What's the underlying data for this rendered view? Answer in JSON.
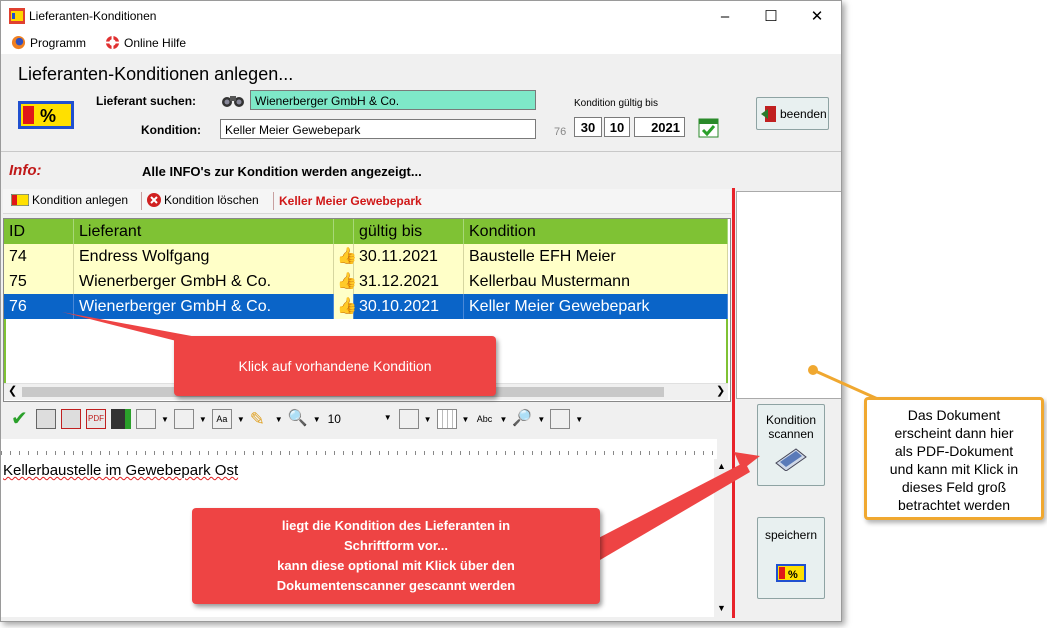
{
  "window": {
    "title": "Lieferanten-Konditionen"
  },
  "menu": {
    "items": [
      {
        "label": "Programm"
      },
      {
        "label": "Online Hilfe"
      }
    ]
  },
  "header": {
    "page_title": "Lieferanten-Konditionen anlegen...",
    "supplier_search_label": "Lieferant suchen:",
    "supplier_value": "Wienerberger GmbH & Co.",
    "condition_label": "Kondition:",
    "condition_value": "Keller Meier Gewebepark",
    "condition_id": "76",
    "valid_until_label": "Kondition gültig bis",
    "valid_day": "30",
    "valid_month": "10",
    "valid_year": "2021",
    "exit_label": "beenden",
    "logo_text": "%"
  },
  "info": {
    "label": "Info:",
    "text": "Alle INFO's zur Kondition werden angezeigt..."
  },
  "toolbar": {
    "add_label": "Kondition anlegen",
    "delete_label": "Kondition löschen",
    "selected_name": "Keller Meier Gewebepark"
  },
  "table": {
    "headers": [
      "ID",
      "Lieferant",
      "gültig bis",
      "Kondition"
    ],
    "rows": [
      {
        "id": "74",
        "supplier": "Endress Wolfgang",
        "valid": "30.11.2021",
        "condition": "Baustelle EFH Meier"
      },
      {
        "id": "75",
        "supplier": "Wienerberger GmbH & Co.",
        "valid": "31.12.2021",
        "condition": "Kellerbau Mustermann"
      },
      {
        "id": "76",
        "supplier": "Wienerberger GmbH & Co.",
        "valid": "30.10.2021",
        "condition": "Keller Meier Gewebepark"
      }
    ]
  },
  "editor": {
    "font_size": "10",
    "text": "Kellerbaustelle im Gewebepark Ost"
  },
  "side_buttons": {
    "scan_label_1": "Kondition",
    "scan_label_2": "scannen",
    "save_label": "speichern"
  },
  "callouts": {
    "click_hint": "Klick auf vorhandene Kondition",
    "scan_line1": "liegt die Kondition des Lieferanten in",
    "scan_line2": "Schriftform vor...",
    "scan_line3": "kann diese optional mit Klick über den",
    "scan_line4a": "Dokumentenscanner",
    "scan_line4b": " gescannt werden",
    "doc_line1": "Das Dokument",
    "doc_line2": "erscheint dann hier",
    "doc_line3": "als PDF-Dokument",
    "doc_line4": "und kann mit Klick in",
    "doc_line5": "dieses Feld groß",
    "doc_line6": "betrachtet werden"
  },
  "colors": {
    "grid_header": "#7fc234",
    "row_normal": "#ffffc8",
    "row_selected": "#0a64c8",
    "accent_red": "#e8222a",
    "callout_orange": "#f0a830"
  }
}
